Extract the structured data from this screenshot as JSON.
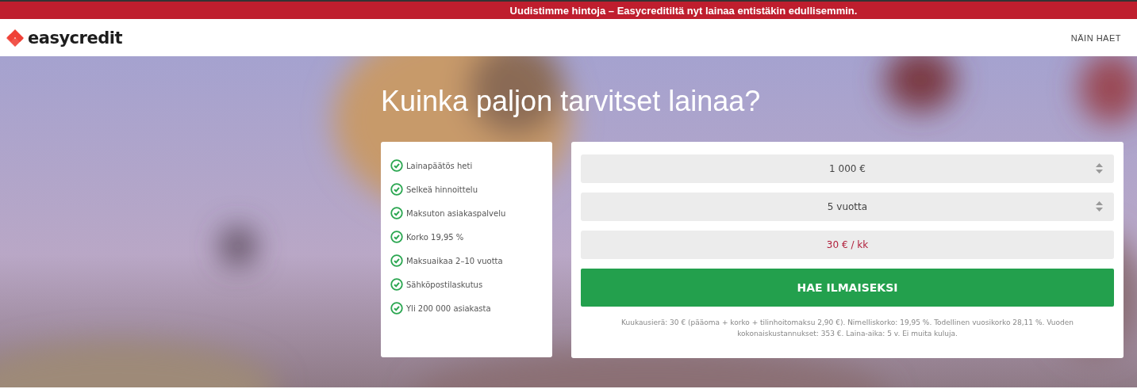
{
  "banner": {
    "text": "Uudistimme hintoja – Easycreditiltä nyt lainaa entistäkin edullisemmin."
  },
  "header": {
    "logo": "easycredit",
    "nav_link": "NÄIN HAET"
  },
  "hero": {
    "kind": "picture",
    "title": "Kuinka paljon tarvitset lainaa?"
  },
  "benefits": [
    "Lainapäätös heti",
    "Selkeä hinnoittelu",
    "Maksuton asiakaspalvelu",
    "Korko 19,95 %",
    "Maksuaikaa 2–10 vuotta",
    "Sähköpostilaskutus",
    "Yli 200 000 asiakasta"
  ],
  "calculator": {
    "amount": "1 000 €",
    "period": "5 vuotta",
    "monthly": "30 € / kk",
    "button": "HAE ILMAISEKSI",
    "disclaimer": "Kuukausierä: 30 € (pääoma + korko + tilinhoitomaksu 2,90 €). Nimelliskorko: 19,95 %. Todellinen vuosikorko 28,11 %. Vuoden kokonaiskustannukset: 353 €. Laina-aika: 5 v. Ei muita kuluja."
  }
}
